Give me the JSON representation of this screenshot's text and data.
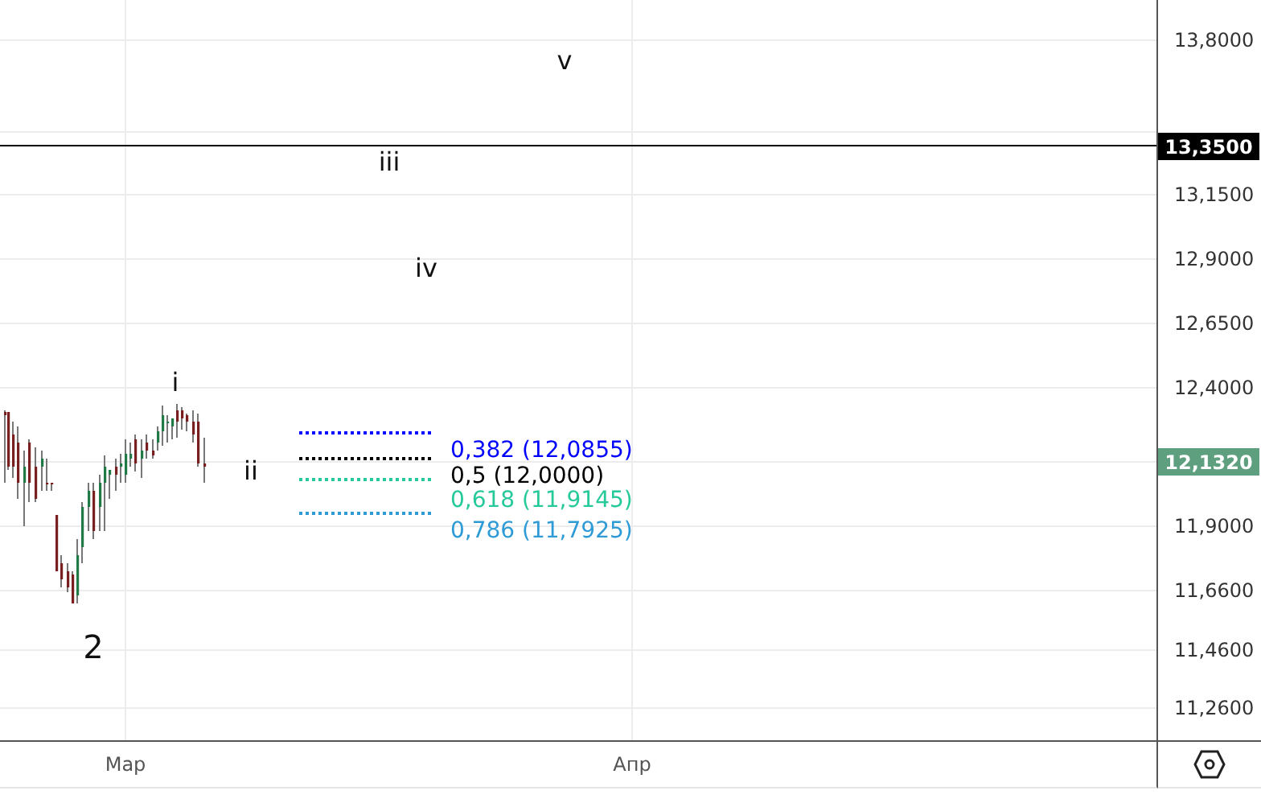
{
  "price_axis": {
    "ticks": [
      "13,8000",
      "13,1500",
      "12,9000",
      "12,6500",
      "12,4000",
      "11,9000",
      "11,6600",
      "11,4600",
      "11,2600"
    ]
  },
  "horizontal_line": {
    "price_label": "13,3500"
  },
  "last_price": {
    "label": "12,1320"
  },
  "wave_labels": [
    {
      "text": "v",
      "kind": "minor"
    },
    {
      "text": "iii",
      "kind": "minor"
    },
    {
      "text": "iv",
      "kind": "minor"
    },
    {
      "text": "i",
      "kind": "minor"
    },
    {
      "text": "ii",
      "kind": "minor"
    },
    {
      "text": "2",
      "kind": "major"
    }
  ],
  "fib_levels": [
    {
      "label": "0,382 (12,0855)",
      "color": "#0000ff"
    },
    {
      "label": "0,5 (12,0000)",
      "color": "#000000"
    },
    {
      "label": "0,618 (11,9145)",
      "color": "#26c99a"
    },
    {
      "label": "0,786 (11,7925)",
      "color": "#2e9bd6"
    }
  ],
  "time_axis": {
    "labels": [
      "Мар",
      "Апр"
    ]
  }
}
